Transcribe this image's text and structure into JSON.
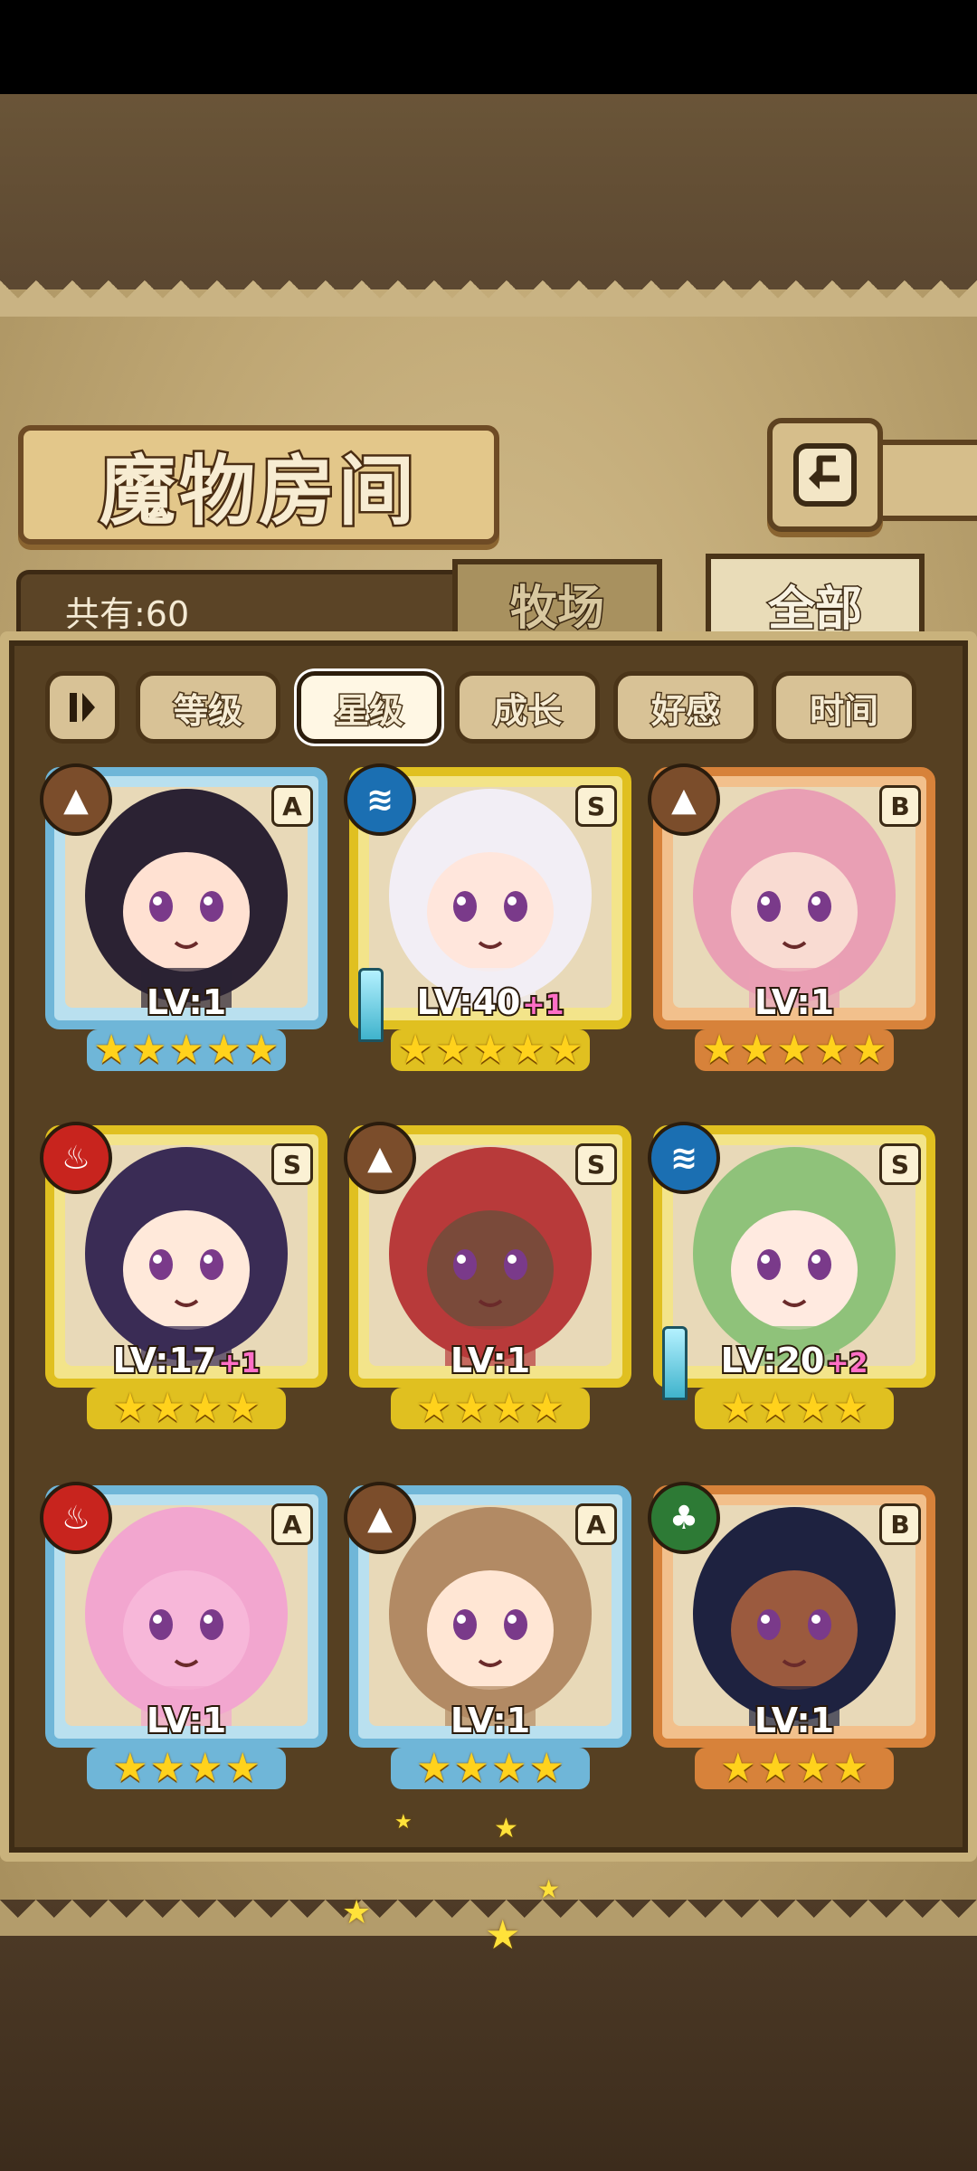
{
  "header": {
    "title": "魔物房间",
    "back_icon": "return-arrow-icon"
  },
  "summary": {
    "count_label": "共有:60"
  },
  "tabs": [
    {
      "label": "牧场",
      "active": false
    },
    {
      "label": "全部",
      "active": true
    }
  ],
  "filters": {
    "toggle_icon": "sort-toggle-icon",
    "buttons": [
      {
        "label": "等级",
        "active": false
      },
      {
        "label": "星级",
        "active": true
      },
      {
        "label": "成长",
        "active": false
      },
      {
        "label": "好感",
        "active": false
      },
      {
        "label": "时间",
        "active": false
      }
    ]
  },
  "monsters": [
    {
      "rank": "A",
      "element": "earth",
      "lv": "LV:1",
      "bonus": "",
      "stars": 5,
      "weapon": false,
      "hair": "#2b2233",
      "skin": "#ffe1d2"
    },
    {
      "rank": "S",
      "element": "water",
      "lv": "LV:40",
      "bonus": "+1",
      "stars": 5,
      "weapon": true,
      "hair": "#f2eef5",
      "skin": "#ffe6dc"
    },
    {
      "rank": "B",
      "element": "earth",
      "lv": "LV:1",
      "bonus": "",
      "stars": 5,
      "weapon": false,
      "hair": "#e99fb4",
      "skin": "#f9dbd2"
    },
    {
      "rank": "S",
      "element": "fire",
      "lv": "LV:17",
      "bonus": "+1",
      "stars": 4,
      "weapon": false,
      "hair": "#3a2c55",
      "skin": "#ffe9da"
    },
    {
      "rank": "S",
      "element": "earth",
      "lv": "LV:1",
      "bonus": "",
      "stars": 4,
      "weapon": false,
      "hair": "#b83a3a",
      "skin": "#7a4a3a"
    },
    {
      "rank": "S",
      "element": "water",
      "lv": "LV:20",
      "bonus": "+2",
      "stars": 4,
      "weapon": true,
      "hair": "#8fc27a",
      "skin": "#ffeae0"
    },
    {
      "rank": "A",
      "element": "fire",
      "lv": "LV:1",
      "bonus": "",
      "stars": 4,
      "weapon": false,
      "hair": "#f2a6cf",
      "skin": "#f7b7d9"
    },
    {
      "rank": "A",
      "element": "earth",
      "lv": "LV:1",
      "bonus": "",
      "stars": 4,
      "weapon": false,
      "hair": "#b28a64",
      "skin": "#ffe6d4"
    },
    {
      "rank": "B",
      "element": "wood",
      "lv": "LV:1",
      "bonus": "",
      "stars": 4,
      "weapon": false,
      "hair": "#1e2240",
      "skin": "#9b5a3e"
    }
  ],
  "colors": {
    "rank_A": "#6fb6d8",
    "rank_S": "#e0c020",
    "rank_B": "#d7823a",
    "bonus": "#ff6fc6"
  }
}
